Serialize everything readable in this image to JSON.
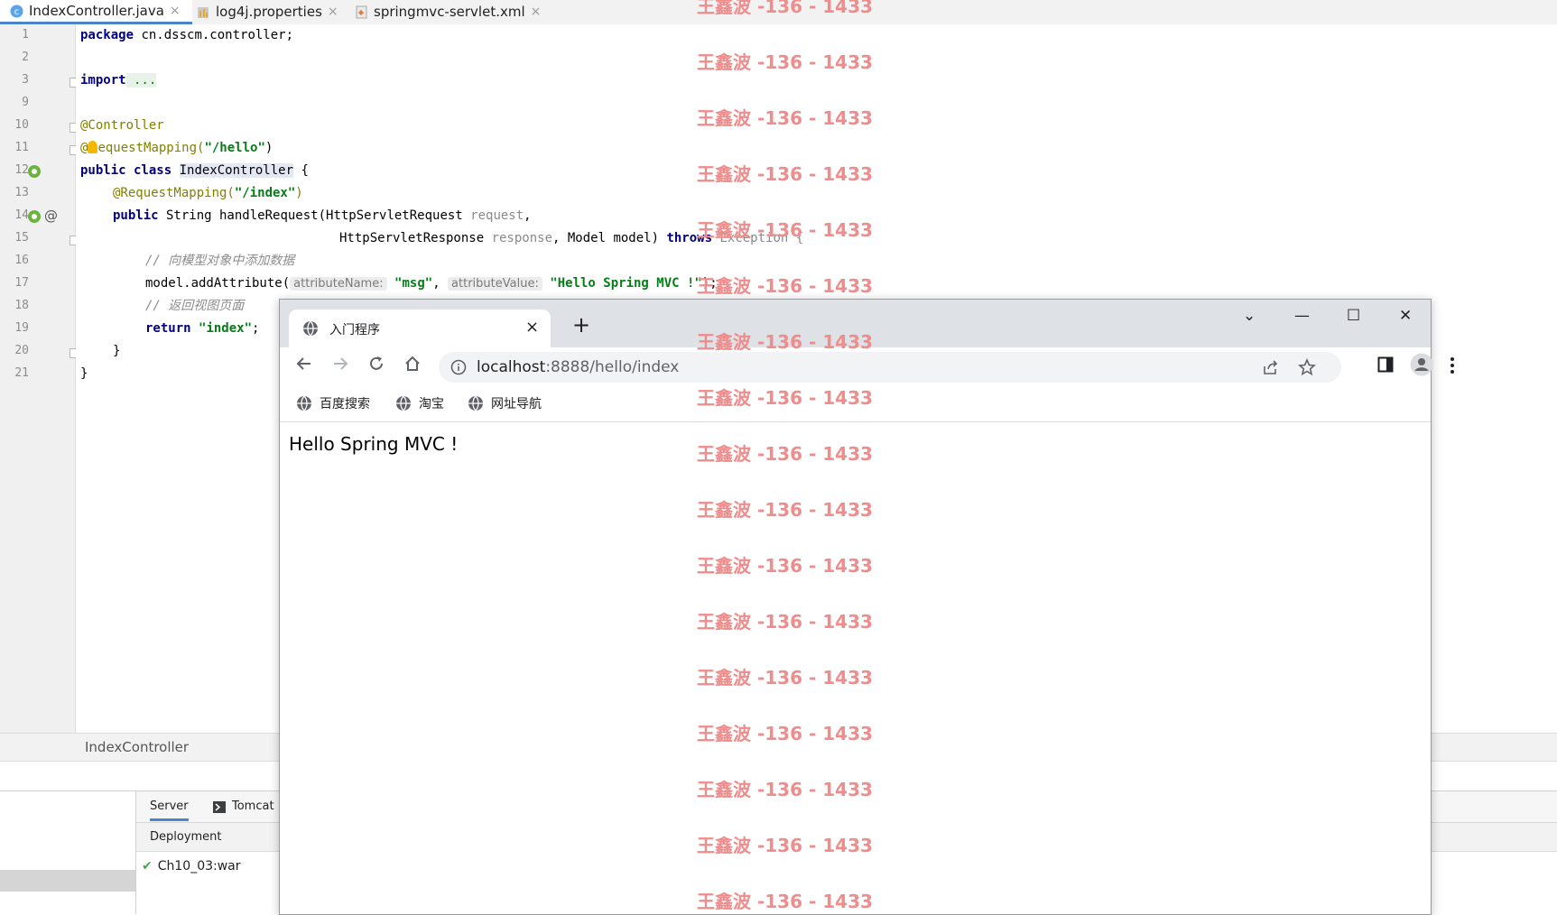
{
  "ide": {
    "tabs": [
      {
        "label": "IndexController.java",
        "icon": "java-class-icon"
      },
      {
        "label": "log4j.properties",
        "icon": "properties-file-icon"
      },
      {
        "label": "springmvc-servlet.xml",
        "icon": "xml-file-icon"
      }
    ],
    "tab_close": "×",
    "line_numbers": [
      "1",
      "2",
      "3",
      "9",
      "10",
      "11",
      "12",
      "13",
      "14",
      "15",
      "16",
      "17",
      "18",
      "19",
      "20",
      "21"
    ],
    "code": {
      "l1_kw": "package",
      "l1_rest": " cn.dsscm.controller;",
      "l3_kw": "import",
      "l3_rest": " ...",
      "l10": "@Controller",
      "l11_a": "@",
      "l11_b": "equestMapping(",
      "l11_str": "\"/hello\"",
      "l11_end": ")",
      "l12_kw": "public class",
      "l12_name": "IndexController",
      "l12_end": " {",
      "l13_ann": "@RequestMapping(",
      "l13_str": "\"/index\"",
      "l13_end": ")",
      "l14_kw": "public",
      "l14_rest": " String handleRequest(HttpServletRequest ",
      "l14_param": "request",
      "l14_end": ",",
      "l15_a": "HttpServletResponse ",
      "l15_param": "response",
      "l15_b": ", Model model) ",
      "l15_kw": "throws",
      "l15_c": " Exception {",
      "l16": "// 向模型对象中添加数据",
      "l17_a": "model.addAttribute(",
      "l17_hint1": "attributeName:",
      "l17_str1": "\"msg\"",
      "l17_b": ", ",
      "l17_hint2": "attributeValue:",
      "l17_str2": "\"Hello Spring MVC !\"",
      "l17_end": ");",
      "l18": "// 返回视图页面",
      "l19_kw": "return",
      "l19_str": "\"index\"",
      "l19_end": ";",
      "l20": "}",
      "l21": "}"
    },
    "breadcrumb": "IndexController",
    "services": {
      "tabs": [
        "Server",
        "Tomcat"
      ],
      "deployment_label": "Deployment",
      "artifact": "Ch10_03:war"
    }
  },
  "browser": {
    "tab_title": "入门程序",
    "tab_close": "×",
    "new_tab": "+",
    "window_controls": [
      "⌄",
      "—",
      "☐",
      "✕"
    ],
    "url_host": "localhost",
    "url_rest": ":8888/hello/index",
    "bookmarks": [
      "百度搜索",
      "淘宝",
      "网址导航"
    ],
    "page_text": "Hello Spring MVC !"
  },
  "watermark": "王鑫波 -136 - 1433",
  "colors": {
    "keyword": "#000080",
    "string": "#067d17",
    "annotation": "#808000",
    "comment": "#8c8c8c",
    "watermark": "#ef8c8c",
    "current_line": "#fcfbe8"
  }
}
